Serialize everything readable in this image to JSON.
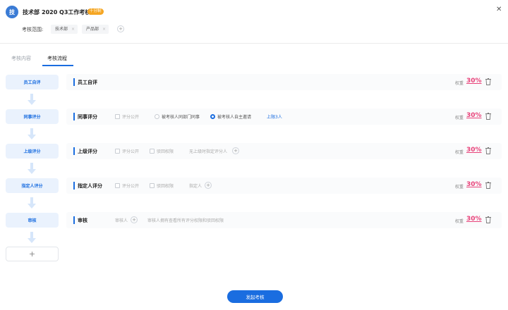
{
  "header": {
    "avatar_char": "技",
    "dept": "技术部",
    "title": "2020 Q3工作考核",
    "badge": "十分制",
    "scope_label": "考核范围:",
    "scope_tags": [
      "技术部",
      "产品部"
    ]
  },
  "tabs": [
    "考核内容",
    "考核流程"
  ],
  "active_tab": 1,
  "steps": [
    "员工自评",
    "同事评分",
    "上级评分",
    "指定人评分",
    "审核"
  ],
  "cards": {
    "self": {
      "title": "员工自评"
    },
    "peer": {
      "title": "同事评分",
      "public_label": "评分公开",
      "radio_dept": "被考核人同部门同事",
      "radio_self": "被考核人自主邀请",
      "limit_link": "上限3人"
    },
    "superior": {
      "title": "上级评分",
      "public_label": "评分公开",
      "reject_label": "驳回权限",
      "no_superior": "无上级时指定评分人"
    },
    "designated": {
      "title": "指定人评分",
      "public_label": "评分公开",
      "reject_label": "驳回权限",
      "designee": "指定人"
    },
    "review": {
      "title": "审核",
      "reviewer": "审核人",
      "note": "审核人拥有查看所有评分权限和驳回权限"
    }
  },
  "weight_label": "权重",
  "weights": [
    "30%",
    "30%",
    "30%",
    "30%",
    "30%"
  ],
  "add_step_symbol": "+",
  "launch_button": "发起考核",
  "colors": {
    "accent": "#1a6de0",
    "weight": "#e8437a",
    "badge": "#f5a623"
  },
  "icons": {
    "close": "close-icon",
    "delete": "trash-icon",
    "add": "plus-icon",
    "arrow": "arrow-down-icon"
  }
}
